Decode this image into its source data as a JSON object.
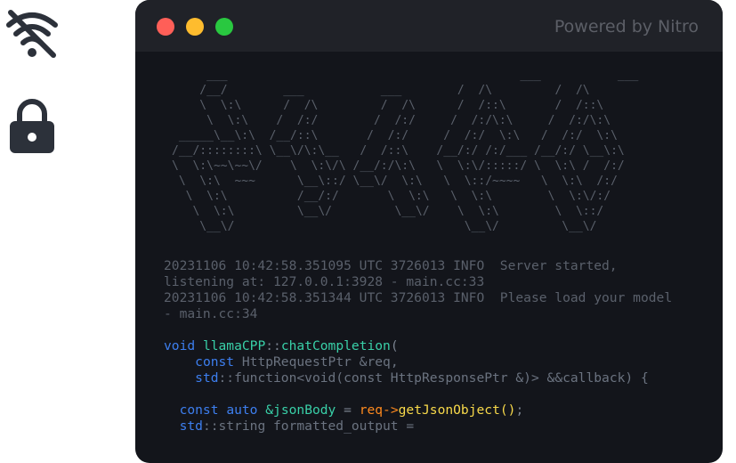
{
  "status_icons": [
    "wifi-off-icon",
    "lock-icon"
  ],
  "window": {
    "title_right": "Powered by Nitro",
    "controls": [
      "close",
      "minimize",
      "maximize"
    ],
    "colors": {
      "close": "#ff5f58",
      "minimize": "#febc2e",
      "maximize": "#29c840",
      "background": "#13151b"
    }
  },
  "ascii_art": "     ___                                          ___           ___     \n    /__/        ___           ___        /  /\\         /  /\\    \n    \\  \\:\\      /  /\\         /  /\\      /  /::\\       /  /::\\   \n     \\  \\:\\    /  /:/        /  /:/     /  /:/\\:\\     /  /:/\\:\\  \n _____\\__\\:\\  /__/::\\       /  /:/     /  /:/  \\:\\   /  /:/  \\:\\ \n/__/::::::::\\ \\__\\/\\:\\__   /  /::\\    /__/:/ /:/___ /__/:/ \\__\\:\\\n\\  \\:\\~~\\~~\\/    \\  \\:\\/\\ /__/:/\\:\\   \\  \\:\\/:::::/ \\  \\:\\ /  /:/\n \\  \\:\\  ~~~      \\__\\::/ \\__\\/  \\:\\   \\  \\::/~~~~   \\  \\:\\  /:/ \n  \\  \\:\\          /__/:/       \\  \\:\\   \\  \\:\\        \\  \\:\\/:/  \n   \\  \\:\\         \\__\\/         \\__\\/    \\  \\:\\        \\  \\::/   \n    \\__\\/                                 \\__\\/         \\__\\/    ",
  "logs": [
    "20231106 10:42:58.351095 UTC 3726013 INFO  Server started,",
    "listening at: 127.0.0.1:3928 - main.cc:33",
    "20231106 10:42:58.351344 UTC 3726013 INFO  Please load your model",
    "- main.cc:34"
  ],
  "code": {
    "l1_kw": "void",
    "l1_cls": "llamaCPP",
    "l1_sep": "::",
    "l1_fn": "chatCompletion",
    "l1_paren": "(",
    "l2_kw": "const",
    "l2_rest": " HttpRequestPtr &req,",
    "l3_ns": "std",
    "l3_rest": "::function<void(const HttpResponsePtr &)> &&callback) {",
    "l5_kw1": "const",
    "l5_kw2": "auto",
    "l5_var": "&jsonBody",
    "l5_eq": " = ",
    "l5_obj": "req->",
    "l5_call": "getJsonObject()",
    "l5_end": ";",
    "l6_ns": "std",
    "l6_rest": "::string formatted_output ="
  }
}
